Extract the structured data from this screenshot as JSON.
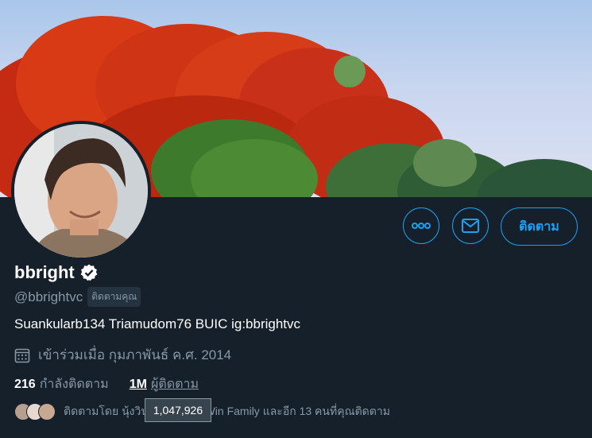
{
  "profile": {
    "display_name": "bbright",
    "handle": "@bbrightvc",
    "follows_you_badge": "ติดตามคุณ",
    "bio": "Suankularb134 Triamudom76 BUIC ig:bbrightvc",
    "joined": "เข้าร่วมเมื่อ กุมภาพันธ์ ค.ศ. 2014",
    "verified": true
  },
  "actions": {
    "more_icon": "more-dots-icon",
    "message_icon": "envelope-icon",
    "follow_label": "ติดตาม"
  },
  "stats": {
    "following_count": "216",
    "following_label": "กำลังติดตาม",
    "followers_count": "1M",
    "followers_label": "ผู้ติดตาม"
  },
  "followed_by": {
    "text": "ติดตามโดย นุ้งวิน ₍ ... ₎ BrightWin Family และอีก 13 คนที่คุณติดตาม"
  },
  "tooltip": {
    "text": "1,047,926"
  },
  "colors": {
    "accent": "#1da1f2",
    "background": "#15202b",
    "muted_text": "#8899a6"
  }
}
